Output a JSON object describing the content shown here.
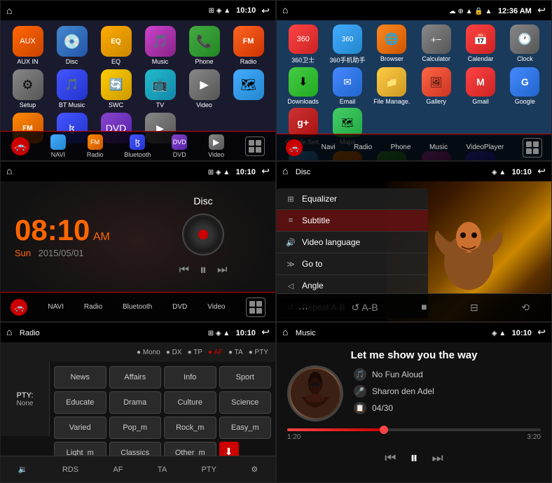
{
  "panels": {
    "p1": {
      "title": "Home",
      "status": {
        "time": "10:10",
        "icons": "⊞ ◈ ▲"
      },
      "apps": [
        {
          "label": "AUX IN",
          "icon": "🔌",
          "class": "icon-aux"
        },
        {
          "label": "Disc",
          "icon": "💿",
          "class": "icon-disc"
        },
        {
          "label": "EQ",
          "icon": "🎛",
          "class": "icon-eq"
        },
        {
          "label": "Music",
          "icon": "🎵",
          "class": "icon-music"
        },
        {
          "label": "Phone",
          "icon": "📞",
          "class": "icon-phone"
        },
        {
          "label": "Radio",
          "icon": "📻",
          "class": "icon-radio"
        },
        {
          "label": "Setup",
          "icon": "⚙",
          "class": "icon-setup"
        },
        {
          "label": "BT Music",
          "icon": "🎵",
          "class": "icon-bt"
        },
        {
          "label": "SWC",
          "icon": "🔄",
          "class": "icon-swc"
        },
        {
          "label": "TV",
          "icon": "📺",
          "class": "icon-tv"
        },
        {
          "label": "Video",
          "icon": "▶",
          "class": "icon-video"
        }
      ],
      "nav": [
        "NAVI",
        "Radio",
        "Bluetooth",
        "DVD",
        "Video"
      ]
    },
    "p2": {
      "title": "Apps",
      "status": {
        "time": "12:36 AM"
      },
      "apps": [
        {
          "label": "360卫士",
          "icon": "🛡",
          "class": "icon-360"
        },
        {
          "label": "360手机助手",
          "icon": "📱",
          "class": "icon-360h"
        },
        {
          "label": "Browser",
          "icon": "🌐",
          "class": "icon-browser"
        },
        {
          "label": "Calculator",
          "icon": "🔢",
          "class": "icon-calc"
        },
        {
          "label": "Calendar",
          "icon": "📅",
          "class": "icon-calendar"
        },
        {
          "label": "Clock",
          "icon": "🕐",
          "class": "icon-clock"
        },
        {
          "label": "Downloads",
          "icon": "⬇",
          "class": "icon-dl"
        },
        {
          "label": "Email",
          "icon": "✉",
          "class": "icon-email"
        },
        {
          "label": "File Manage.",
          "icon": "📁",
          "class": "icon-filem"
        },
        {
          "label": "Gallery",
          "icon": "🖼",
          "class": "icon-gallery"
        },
        {
          "label": "Gmail",
          "icon": "M",
          "class": "icon-gmail"
        },
        {
          "label": "Google",
          "icon": "G",
          "class": "icon-google"
        },
        {
          "label": "Google Sett.",
          "icon": "g",
          "class": "icon-gplus"
        },
        {
          "label": "Maps",
          "icon": "🗺",
          "class": "icon-maps"
        }
      ],
      "nav": [
        "Navi",
        "Radio",
        "Phone",
        "Music",
        "VideoPlayer"
      ]
    },
    "p3": {
      "status": {
        "time": "10:10"
      },
      "clock": {
        "time": "08:10",
        "ampm": "AM",
        "day": "Sun",
        "date": "2015/05/01"
      },
      "disc": {
        "label": "Disc"
      },
      "nav": [
        "NAVI",
        "Radio",
        "Bluetooth",
        "DVD",
        "Video"
      ]
    },
    "p4": {
      "title": "Disc",
      "status": {
        "time": "10:10"
      },
      "menu": [
        {
          "icon": "⊞",
          "label": "Equalizer"
        },
        {
          "icon": "≡",
          "label": "Subtitle"
        },
        {
          "icon": "🔊",
          "label": "Video language"
        },
        {
          "icon": "≫",
          "label": "Go to"
        },
        {
          "icon": "◁",
          "label": "Angle"
        },
        {
          "icon": "↺",
          "label": "Repeat A-B"
        }
      ]
    },
    "p5": {
      "title": "Radio",
      "status": {
        "time": "10:10"
      },
      "header_items": [
        "Mono",
        "DX",
        "TP",
        "AF",
        "TA",
        "PTY"
      ],
      "active_items": [
        "AF"
      ],
      "pty": "None",
      "buttons": [
        "News",
        "Affairs",
        "Info",
        "Sport",
        "Educate",
        "Drama",
        "Culture",
        "Science",
        "Varied",
        "Pop_m",
        "Rock_m",
        "Easy_m",
        "Light_m",
        "Classics",
        "Other_m",
        ""
      ],
      "bottom": [
        "RDS",
        "AF",
        "TA",
        "PTY"
      ]
    },
    "p6": {
      "title": "Music",
      "status": {
        "time": "10:10"
      },
      "song": "Let me show you the way",
      "artist1": "No Fun Aloud",
      "artist2": "Sharon den Adel",
      "track": "04/30",
      "time_current": "1:20",
      "time_total": "3:20",
      "progress": 38
    }
  }
}
